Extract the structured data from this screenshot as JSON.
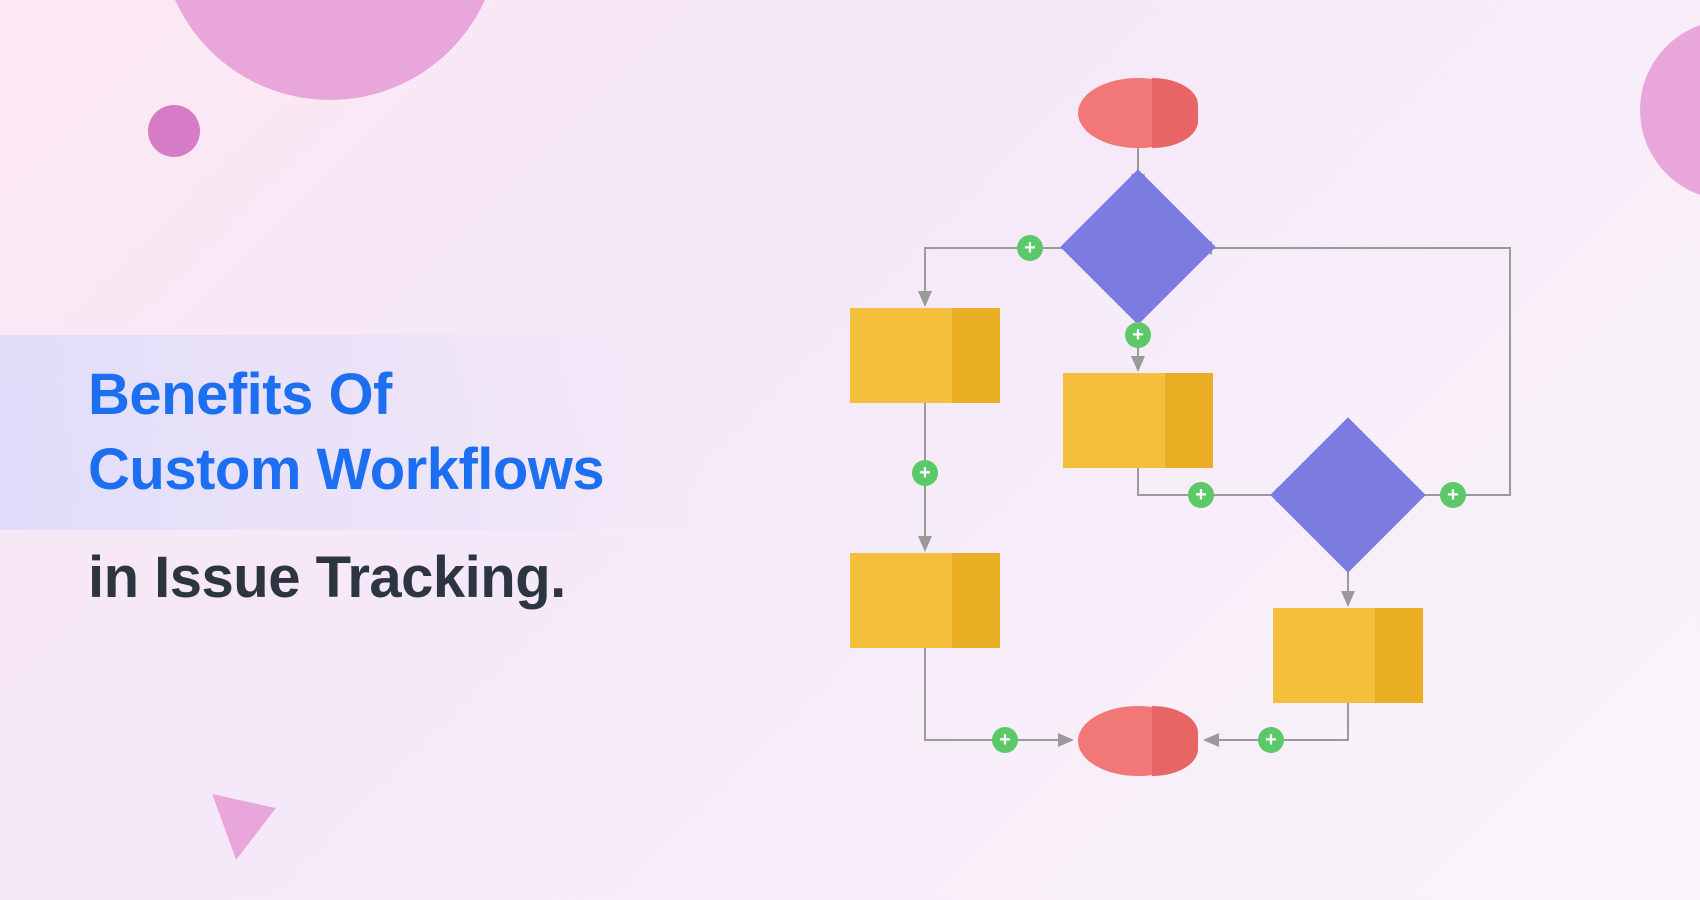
{
  "heading": {
    "line1": "Benefits Of",
    "line2": "Custom Workflows",
    "line3": "in Issue Tracking."
  },
  "colors": {
    "accent_blue": "#1d6ff2",
    "dark_text": "#2c3540",
    "terminator": "#f27878",
    "decision": "#7b7be0",
    "process": "#f5bf3e",
    "plus_badge": "#5bc968",
    "decorative_pink": "#e8a6da"
  },
  "diagram": {
    "type": "flowchart",
    "nodes": [
      {
        "id": "start",
        "shape": "terminator",
        "color": "coral"
      },
      {
        "id": "decision1",
        "shape": "decision",
        "color": "purple"
      },
      {
        "id": "process_left1",
        "shape": "process",
        "color": "yellow"
      },
      {
        "id": "process_mid",
        "shape": "process",
        "color": "yellow"
      },
      {
        "id": "decision2",
        "shape": "decision",
        "color": "purple"
      },
      {
        "id": "process_left2",
        "shape": "process",
        "color": "yellow"
      },
      {
        "id": "process_right",
        "shape": "process",
        "color": "yellow"
      },
      {
        "id": "end",
        "shape": "terminator",
        "color": "coral"
      }
    ],
    "edges": [
      {
        "from": "start",
        "to": "decision1"
      },
      {
        "from": "decision1",
        "to": "process_left1",
        "plus": true
      },
      {
        "from": "decision1",
        "to": "process_mid",
        "plus": true
      },
      {
        "from": "process_left1",
        "to": "process_left2",
        "plus": true
      },
      {
        "from": "process_mid",
        "to": "decision2",
        "plus": true
      },
      {
        "from": "decision2",
        "to": "process_right"
      },
      {
        "from": "decision2",
        "to": "decision1",
        "loopback": true,
        "plus": true
      },
      {
        "from": "process_left2",
        "to": "end",
        "plus": true
      },
      {
        "from": "process_right",
        "to": "end",
        "plus": true
      }
    ]
  }
}
